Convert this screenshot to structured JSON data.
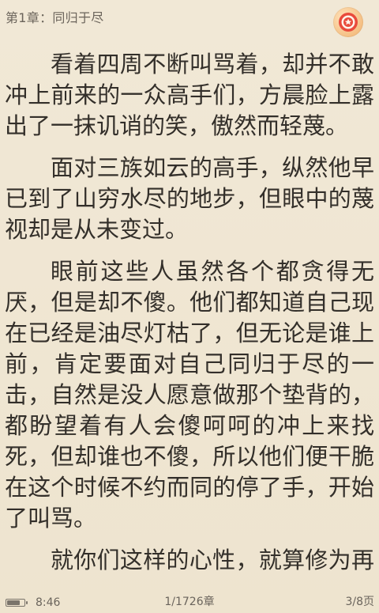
{
  "header": {
    "chapter_title": "第1章：同归于尽",
    "badge_icon": "red-circle-star-icon"
  },
  "content": {
    "paragraphs": [
      "看着四周不断叫骂着，却并不敢冲上前来的一众高手们，方晨脸上露出了一抹讥诮的笑，傲然而轻蔑。",
      "面对三族如云的高手，纵然他早已到了山穷水尽的地步，但眼中的蔑视却是从未变过。",
      "眼前这些人虽然各个都贪得无厌，但是却不傻。他们都知道自己现在已经是油尽灯枯了，但无论是谁上前，肯定要面对自己同归于尽的一击，自然是没人愿意做那个垫背的，都盼望着有人会傻呵呵的冲上来找死，但却谁也不傻，所以他们便干脆在这个时候不约而同的停了手，开始了叫骂。",
      "就你们这样的心性，就算修为再高，人数再多，也配与我为敌？也配"
    ]
  },
  "footer": {
    "battery_level": 0.78,
    "time": "8:46",
    "chapter_progress": "1/1726章",
    "page_progress": "3/8页"
  },
  "colors": {
    "background": "#efe6d2",
    "text": "#332f2a",
    "muted": "#6b645b",
    "badge_outer": "#f5c48a",
    "badge_red": "#e94b3c"
  }
}
